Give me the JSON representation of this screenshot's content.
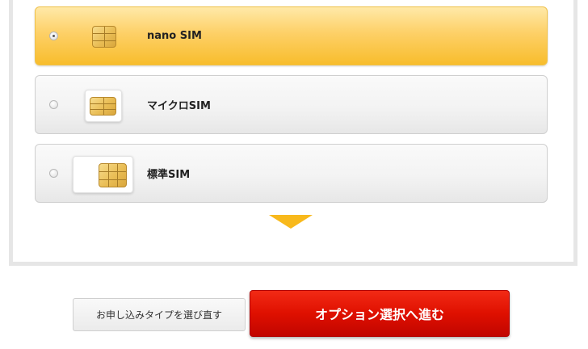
{
  "sim_options": [
    {
      "label": "nano SIM",
      "icon": "nano-sim-icon",
      "selected": true
    },
    {
      "label": "マイクロSIM",
      "icon": "micro-sim-icon",
      "selected": false
    },
    {
      "label": "標準SIM",
      "icon": "standard-sim-icon",
      "selected": false
    }
  ],
  "buttons": {
    "back_label": "お申し込みタイプを選び直す",
    "next_label": "オプション選択へ進む"
  },
  "colors": {
    "selected_fill": "#fdd067",
    "arrow": "#f8b91c",
    "next_button": "#df1000"
  }
}
